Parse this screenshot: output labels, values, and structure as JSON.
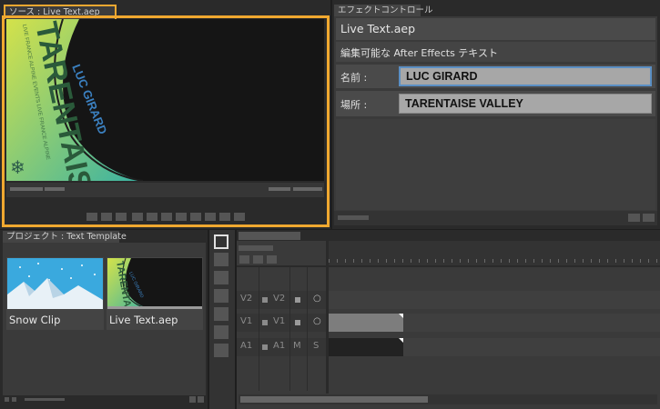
{
  "source_panel": {
    "tab_label": "ソース : Live Text.aep",
    "thumbnail_texts": {
      "big_title": "TARENTAISE",
      "name": "LUC GIRARD",
      "ring_text": "LIVE FRANCE ALPINE EVENTS LIVE FRANCE ALPINE"
    }
  },
  "effect_controls": {
    "tab_label": "エフェクトコントロール",
    "file_name": "Live Text.aep",
    "description": "編集可能な After Effects テキスト",
    "fields": [
      {
        "label": "名前 :",
        "value": "LUC GIRARD"
      },
      {
        "label": "場所 :",
        "value": "TARENTAISE VALLEY"
      }
    ]
  },
  "project_panel": {
    "tab_label": "プロジェクト : Text Template",
    "items": [
      {
        "name": "Snow Clip",
        "icon": "snow-clip-thumbnail"
      },
      {
        "name": "Live Text.aep",
        "icon": "live-text-thumbnail"
      }
    ]
  },
  "timeline": {
    "tracks": [
      {
        "id": "V2",
        "label": "V2",
        "name": "V2",
        "btn1": "",
        "btn2": "○"
      },
      {
        "id": "V1",
        "label": "V1",
        "name": "V1",
        "btn1": "",
        "btn2": "○"
      },
      {
        "id": "A1",
        "label": "A1",
        "name": "A1",
        "btn1": "M",
        "btn2": "S"
      }
    ]
  },
  "colors": {
    "highlight": "#f0a830",
    "accent_blue": "#5b8fc4",
    "thumbnail_gradient_start": "#c8e04a",
    "thumbnail_gradient_end": "#3fb5a0"
  }
}
